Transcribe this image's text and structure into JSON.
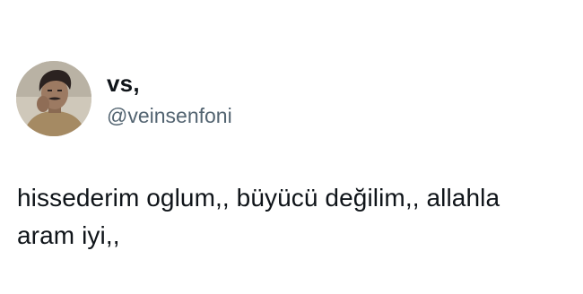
{
  "tweet": {
    "author": {
      "display_name": "vs,",
      "handle": "@veinsenfoni",
      "avatar_icon": "profile-photo"
    },
    "text_lines": [
      "hissederim oglum,, büyücü değilim,, allahla",
      "aram iyi,,"
    ]
  },
  "colors": {
    "background": "#ffffff",
    "text_primary": "#0f1419",
    "text_secondary": "#536471"
  }
}
